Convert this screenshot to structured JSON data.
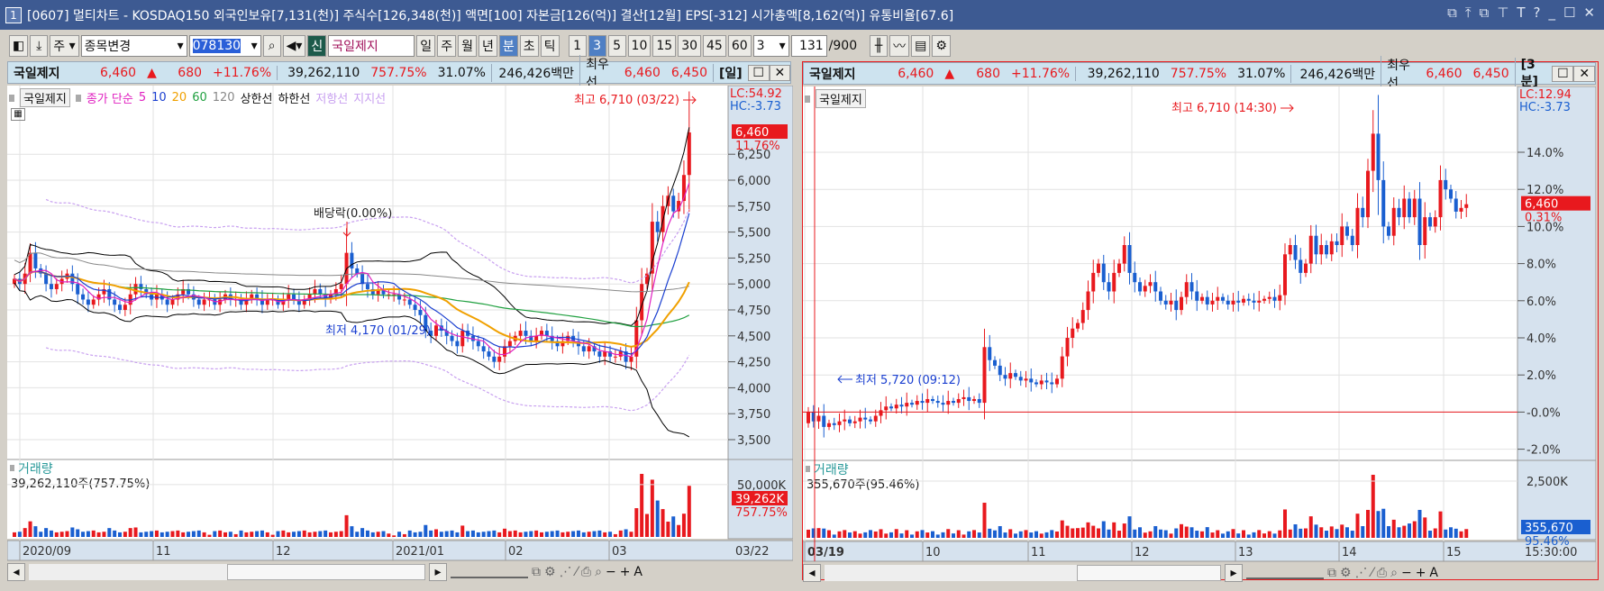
{
  "title": {
    "num": "1",
    "text": "[0607] 멀티차트 - KOSDAQ150 외국인보유[7,131(천)] 주식수[126,348(천)] 액면[100] 자본금[126(억)] 결산[12월] EPS[-312] 시가총액[8,162(억)] 유통비율[67.6]",
    "controls": [
      "⧉",
      "⤒",
      "⧉",
      "⊤",
      "T",
      "?",
      "_",
      "☐",
      "✕"
    ]
  },
  "toolbar": {
    "market": "주",
    "change_label": "종목변경",
    "code": "078130",
    "new_badge": "신",
    "stock_name": "국일제지",
    "periods": [
      "일",
      "주",
      "월",
      "년",
      "분",
      "초",
      "틱"
    ],
    "selected_period": "분",
    "intervals": [
      "1",
      "3",
      "5",
      "10",
      "15",
      "30",
      "45",
      "60"
    ],
    "selected_interval": "3",
    "interval_value": "3",
    "count": "131",
    "count_max": "/900"
  },
  "colors": {
    "up": "#e8191e",
    "down": "#1a5fd0",
    "ma5": "#e020c0",
    "ma10": "#1a3fd0",
    "ma20": "#f0a000",
    "ma60": "#20a040",
    "ma120": "#888888",
    "band": "#000000",
    "envelope": "#c8a0f0"
  },
  "left": {
    "info": {
      "name": "국일제지",
      "price": "6,460",
      "arrow": "▲",
      "change": "680",
      "pct": "+11.76%",
      "volume": "39,262,110",
      "vol_pct": "757.75%",
      "turnover": "31.07%",
      "amount": "246,426백만",
      "best_label": "최우선",
      "ask": "6,460",
      "bid": "6,450",
      "period": "[일]"
    },
    "legend": {
      "name": "국일제지",
      "price_type": "종가 단순",
      "ma": [
        "5",
        "10",
        "20",
        "60",
        "120"
      ],
      "upper": "상한선",
      "lower": "하한선",
      "resist": "저항선",
      "support": "지지선"
    },
    "lc": "LC:54.92",
    "hc": "HC:-3.73",
    "price_tag": "6,460",
    "price_tag_pct": "11.76%",
    "high_note": "최고 6,710 (03/22)",
    "low_note": "최저 4,170 (01/29)",
    "event_note": "배당락(0.00%)",
    "y_ticks": [
      "6,250",
      "6,000",
      "5,750",
      "5,500",
      "5,250",
      "5,000",
      "4,750",
      "4,500",
      "4,250",
      "4,000",
      "3,750",
      "3,500"
    ],
    "volume": {
      "label": "거래량",
      "value": "39,262,110주(757.75%)",
      "tick": "50,000K",
      "tag": "39,262K",
      "tag_pct": "757.75%"
    },
    "x_labels": [
      "2020/09",
      "11",
      "12",
      "2021/01",
      "02",
      "03"
    ],
    "last_date": "03/22",
    "closes": [
      5050,
      5000,
      5100,
      5300,
      5150,
      5100,
      5000,
      4950,
      5000,
      5050,
      5100,
      5000,
      4900,
      4850,
      4800,
      4850,
      4900,
      4950,
      4850,
      4800,
      4750,
      4800,
      4900,
      5000,
      4950,
      4900,
      4850,
      4900,
      4850,
      4800,
      4850,
      4900,
      4950,
      4900,
      4850,
      4800,
      4850,
      4850,
      4800,
      4850,
      4900,
      4850,
      4850,
      4800,
      4850,
      4900,
      4850,
      4800,
      4850,
      4850,
      4800,
      4850,
      4900,
      4850,
      4800,
      4850,
      4900,
      4950,
      4900,
      4850,
      4900,
      4950,
      5000,
      5300,
      5150,
      5100,
      5000,
      4950,
      4900,
      4950,
      4900,
      4900,
      4900,
      4850,
      4850,
      4800,
      4750,
      4700,
      4550,
      4500,
      4600,
      4550,
      4500,
      4450,
      4400,
      4550,
      4500,
      4450,
      4400,
      4350,
      4300,
      4250,
      4300,
      4400,
      4450,
      4500,
      4550,
      4500,
      4450,
      4500,
      4550,
      4500,
      4450,
      4400,
      4450,
      4500,
      4450,
      4400,
      4350,
      4400,
      4350,
      4300,
      4350,
      4300,
      4300,
      4350,
      4250,
      4300,
      4650,
      5000,
      5100,
      5600,
      5500,
      5750,
      5850,
      5700,
      5800,
      6050,
      6460
    ]
  },
  "right": {
    "info": {
      "name": "국일제지",
      "price": "6,460",
      "arrow": "▲",
      "change": "680",
      "pct": "+11.76%",
      "volume": "39,262,110",
      "vol_pct": "757.75%",
      "turnover": "31.07%",
      "amount": "246,426백만",
      "best_label": "최우선",
      "ask": "6,460",
      "bid": "6,450",
      "period": "[3분]"
    },
    "legend": {
      "name": "국일제지"
    },
    "lc": "LC:12.94",
    "hc": "HC:-3.73",
    "price_tag": "6,460",
    "price_tag_pct": "0.31%",
    "high_note": "최고 6,710 (14:30)",
    "low_note": "최저 5,720 (09:12)",
    "y_ticks": [
      "14.0%",
      "12.0%",
      "10.0%",
      "8.0%",
      "6.0%",
      "4.0%",
      "2.0%",
      "-0.0%",
      "-2.0%"
    ],
    "volume": {
      "label": "거래량",
      "value": "355,670주(95.46%)",
      "tick": "2,500K",
      "tag": "355,670",
      "tag_pct": "95.46%"
    },
    "x_labels": [
      "03/19",
      "10",
      "11",
      "12",
      "13",
      "14",
      "15"
    ],
    "last_time": "15:30:00",
    "pct_closes": [
      0,
      -0.5,
      -0.2,
      -0.8,
      -0.6,
      -0.7,
      -0.5,
      -0.4,
      -0.6,
      -0.5,
      -0.3,
      -0.4,
      -0.5,
      -0.2,
      0.1,
      0.3,
      0.2,
      0.4,
      0.3,
      0.5,
      0.4,
      0.6,
      0.5,
      0.7,
      0.6,
      0.5,
      0.4,
      0.6,
      0.5,
      0.7,
      0.8,
      0.6,
      0.7,
      0.5,
      3.5,
      2.8,
      2.5,
      2.0,
      1.8,
      2.1,
      1.9,
      1.7,
      1.8,
      1.6,
      1.5,
      1.7,
      1.6,
      1.5,
      1.8,
      3.0,
      4.0,
      4.5,
      4.8,
      5.5,
      6.5,
      7.5,
      8.0,
      7.0,
      6.5,
      7.5,
      8.0,
      9.0,
      7.5,
      7.0,
      6.5,
      6.8,
      7.0,
      6.5,
      6.0,
      5.8,
      6.0,
      5.5,
      6.2,
      7.0,
      6.5,
      6.0,
      6.2,
      5.8,
      6.0,
      6.2,
      6.0,
      5.8,
      6.0,
      5.9,
      6.1,
      6.0,
      5.9,
      6.0,
      6.1,
      6.2,
      6.0,
      6.3,
      8.5,
      9.0,
      8.2,
      7.5,
      8.0,
      9.5,
      8.5,
      9.0,
      8.5,
      9.2,
      9.0,
      10.0,
      9.5,
      9.0,
      11.0,
      10.5,
      13.0,
      15.0,
      12.5,
      10.0,
      9.5,
      11.0,
      10.5,
      11.5,
      10.5,
      11.5,
      9.0,
      10.5,
      10.0,
      10.5,
      12.5,
      12.0,
      11.5,
      10.8,
      11.0,
      11.2
    ]
  },
  "bottom_tools": [
    "◂",
    "▸",
    "−",
    "+",
    "A"
  ]
}
